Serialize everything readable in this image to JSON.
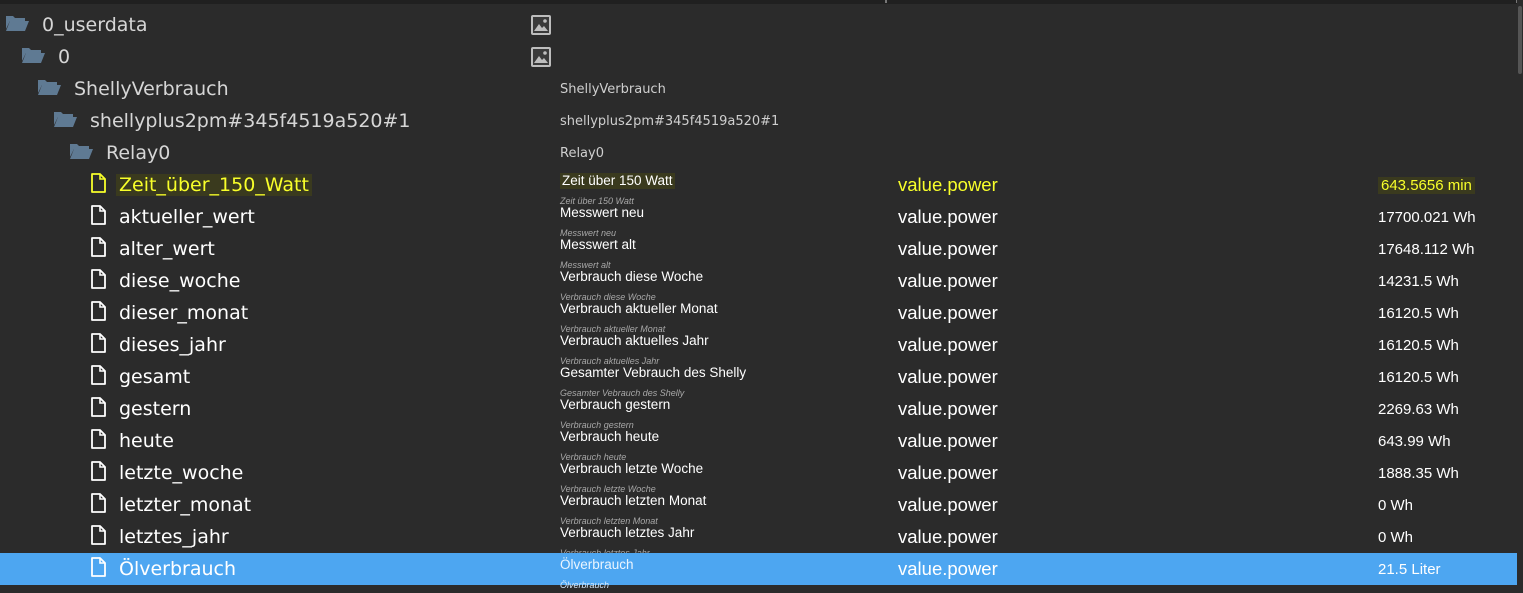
{
  "colors": {
    "background": "#2b2b2b",
    "selected_row": "#4da6f1",
    "highlight_text": "#f8ff2a",
    "folder_icon": "#5f7a93"
  },
  "tree": [
    {
      "type": "folder",
      "name": "0_userdata",
      "depth": 0,
      "icon": "folder-open-icon",
      "has_image_icon": true
    },
    {
      "type": "folder",
      "name": "0",
      "depth": 1,
      "icon": "folder-open-icon",
      "has_image_icon": true
    },
    {
      "type": "folder",
      "name": "ShellyVerbrauch",
      "depth": 2,
      "icon": "folder-open-icon",
      "desc": "ShellyVerbrauch"
    },
    {
      "type": "folder",
      "name": "shellyplus2pm#345f4519a520#1",
      "depth": 3,
      "icon": "folder-open-icon",
      "desc": "shellyplus2pm#345f4519a520#1"
    },
    {
      "type": "folder",
      "name": "Relay0",
      "depth": 4,
      "icon": "folder-open-icon",
      "desc": "Relay0"
    },
    {
      "type": "file",
      "name": "Zeit_über_150_Watt",
      "icon": "file-icon",
      "desc": "Zeit über 150 Watt",
      "desc_sub": "Zeit über 150 Watt",
      "role": "value.power",
      "value": "643.5656 min",
      "highlighted": true
    },
    {
      "type": "file",
      "name": "aktueller_wert",
      "icon": "file-icon",
      "desc": "Messwert neu",
      "desc_sub": "Messwert neu",
      "role": "value.power",
      "value": "17700.021 Wh"
    },
    {
      "type": "file",
      "name": "alter_wert",
      "icon": "file-icon",
      "desc": "Messwert alt",
      "desc_sub": "Messwert alt",
      "role": "value.power",
      "value": "17648.112 Wh"
    },
    {
      "type": "file",
      "name": "diese_woche",
      "icon": "file-icon",
      "desc": "Verbrauch diese Woche",
      "desc_sub": "Verbrauch diese Woche",
      "role": "value.power",
      "value": "14231.5 Wh"
    },
    {
      "type": "file",
      "name": "dieser_monat",
      "icon": "file-icon",
      "desc": "Verbrauch aktueller Monat",
      "desc_sub": "Verbrauch aktueller Monat",
      "role": "value.power",
      "value": "16120.5 Wh"
    },
    {
      "type": "file",
      "name": "dieses_jahr",
      "icon": "file-icon",
      "desc": "Verbrauch aktuelles Jahr",
      "desc_sub": "Verbrauch aktuelles Jahr",
      "role": "value.power",
      "value": "16120.5 Wh"
    },
    {
      "type": "file",
      "name": "gesamt",
      "icon": "file-icon",
      "desc": "Gesamter Vebrauch des Shelly",
      "desc_sub": "Gesamter Vebrauch des Shelly",
      "role": "value.power",
      "value": "16120.5 Wh"
    },
    {
      "type": "file",
      "name": "gestern",
      "icon": "file-icon",
      "desc": "Verbrauch gestern",
      "desc_sub": "Verbrauch gestern",
      "role": "value.power",
      "value": "2269.63 Wh"
    },
    {
      "type": "file",
      "name": "heute",
      "icon": "file-icon",
      "desc": "Verbrauch heute",
      "desc_sub": "Verbrauch heute",
      "role": "value.power",
      "value": "643.99 Wh"
    },
    {
      "type": "file",
      "name": "letzte_woche",
      "icon": "file-icon",
      "desc": "Verbrauch letzte Woche",
      "desc_sub": "Verbrauch letzte Woche",
      "role": "value.power",
      "value": "1888.35 Wh"
    },
    {
      "type": "file",
      "name": "letzter_monat",
      "icon": "file-icon",
      "desc": "Verbrauch letzten Monat",
      "desc_sub": "Verbrauch letzten Monat",
      "role": "value.power",
      "value": "0 Wh"
    },
    {
      "type": "file",
      "name": "letztes_jahr",
      "icon": "file-icon",
      "desc": "Verbrauch letztes Jahr",
      "desc_sub": "Verbrauch letztes Jahr",
      "role": "value.power",
      "value": "0 Wh"
    },
    {
      "type": "file",
      "name": "Ölverbrauch",
      "icon": "file-icon",
      "desc": "Ölverbrauch",
      "desc_sub": "Ölverbrauch",
      "role": "value.power",
      "value": "21.5 Liter",
      "selected": true
    }
  ]
}
